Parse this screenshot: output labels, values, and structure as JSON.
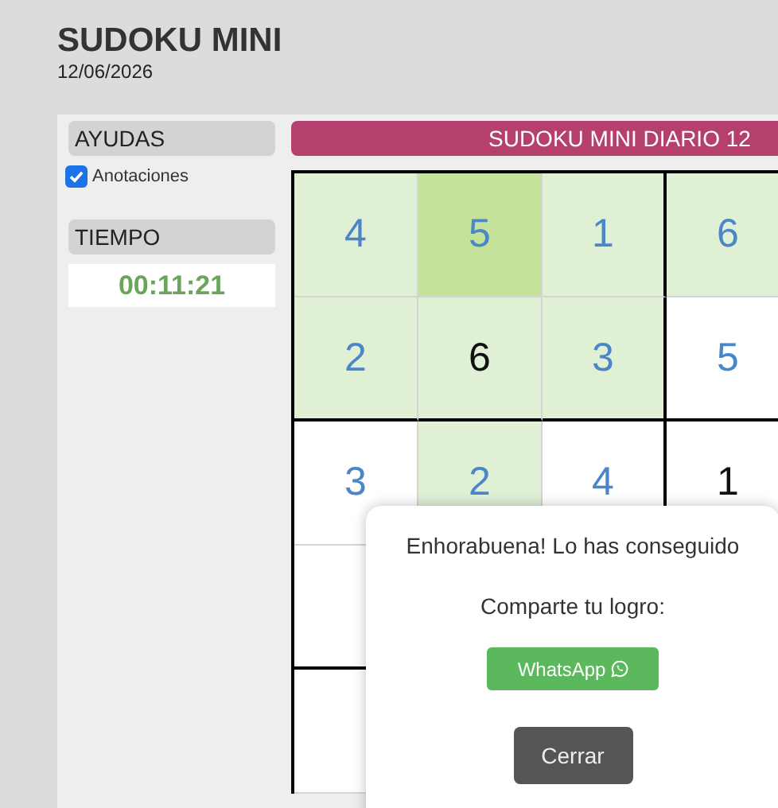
{
  "header": {
    "title": "SUDOKU MINI",
    "date": "12/06/2026"
  },
  "sidebar": {
    "aids_heading": "AYUDAS",
    "aids": [
      {
        "label": "Anotaciones",
        "checked": true
      }
    ],
    "time_heading": "TIEMPO",
    "time": "00:11:21"
  },
  "banner": "SUDOKU MINI DIARIO 12",
  "board": {
    "rows": [
      [
        {
          "value": "4",
          "given": false,
          "highlighted": true,
          "selected": false
        },
        {
          "value": "5",
          "given": false,
          "highlighted": true,
          "selected": true
        },
        {
          "value": "1",
          "given": false,
          "highlighted": true,
          "selected": false
        },
        {
          "value": "6",
          "given": false,
          "highlighted": true,
          "selected": false
        }
      ],
      [
        {
          "value": "2",
          "given": false,
          "highlighted": true,
          "selected": false
        },
        {
          "value": "6",
          "given": true,
          "highlighted": true,
          "selected": false
        },
        {
          "value": "3",
          "given": false,
          "highlighted": true,
          "selected": false
        },
        {
          "value": "5",
          "given": false,
          "highlighted": false,
          "selected": false
        }
      ],
      [
        {
          "value": "3",
          "given": false,
          "highlighted": false,
          "selected": false
        },
        {
          "value": "2",
          "given": false,
          "highlighted": true,
          "selected": false
        },
        {
          "value": "4",
          "given": false,
          "highlighted": false,
          "selected": false
        },
        {
          "value": "1",
          "given": true,
          "highlighted": false,
          "selected": false
        }
      ],
      [
        {
          "highlighted": false,
          "selected": false
        }
      ],
      [
        {
          "highlighted": false,
          "selected": false
        }
      ]
    ]
  },
  "dialog": {
    "message": "Enhorabuena! Lo has conseguido",
    "share_label": "Comparte tu logro:",
    "share_button": "WhatsApp",
    "close_button": "Cerrar"
  }
}
